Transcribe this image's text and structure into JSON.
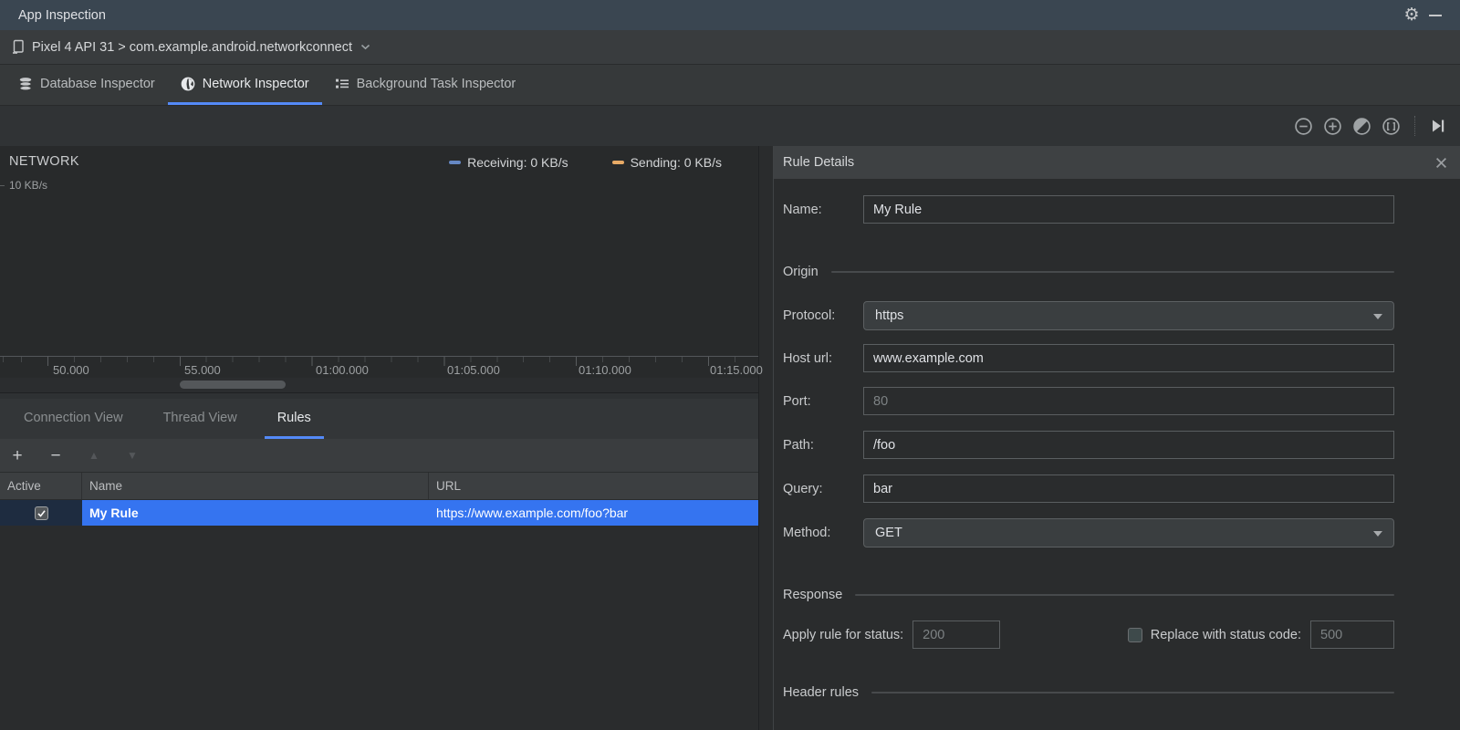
{
  "titlebar": {
    "title": "App Inspection"
  },
  "device_bar": {
    "selection": "Pixel 4 API 31 > com.example.android.networkconnect"
  },
  "inspector_tabs": {
    "items": [
      {
        "label": "Database Inspector",
        "active": false
      },
      {
        "label": "Network Inspector",
        "active": true
      },
      {
        "label": "Background Task Inspector",
        "active": false
      }
    ]
  },
  "timeline": {
    "title": "NETWORK",
    "y_label": "10 KB/s",
    "legend": {
      "receiving": {
        "label": "Receiving: 0 KB/s",
        "color": "#6688c4"
      },
      "sending": {
        "label": "Sending: 0 KB/s",
        "color": "#e8aa66"
      }
    },
    "x_ticks": [
      "50.000",
      "55.000",
      "01:00.000",
      "01:05.000",
      "01:10.000",
      "01:15.000"
    ],
    "receiving_kbs": 0,
    "sending_kbs": 0
  },
  "view_tabs": {
    "items": [
      {
        "label": "Connection View",
        "active": false
      },
      {
        "label": "Thread View",
        "active": false
      },
      {
        "label": "Rules",
        "active": true
      }
    ]
  },
  "rules_toolbar": {
    "add": "+",
    "remove": "−",
    "up": "▲",
    "down": "▼"
  },
  "rules_table": {
    "columns": [
      "Active",
      "Name",
      "URL"
    ],
    "rows": [
      {
        "active": true,
        "name": "My Rule",
        "url": "https://www.example.com/foo?bar",
        "selected": true
      }
    ]
  },
  "rule_details": {
    "title": "Rule Details",
    "name": {
      "label": "Name:",
      "value": "My Rule"
    },
    "sections": {
      "origin": "Origin",
      "response": "Response",
      "header_rules": "Header rules"
    },
    "protocol": {
      "label": "Protocol:",
      "value": "https"
    },
    "host": {
      "label": "Host url:",
      "value": "www.example.com"
    },
    "port": {
      "label": "Port:",
      "value": "80"
    },
    "path": {
      "label": "Path:",
      "value": "/foo"
    },
    "query": {
      "label": "Query:",
      "value": "bar"
    },
    "method": {
      "label": "Method:",
      "value": "GET"
    },
    "status": {
      "apply_label": "Apply rule for status:",
      "apply_value": "200",
      "replace_label": "Replace with status code:",
      "replace_value": "500",
      "replace_checked": false
    }
  },
  "colors": {
    "accent": "#548af7",
    "selection_blue": "#3574f0",
    "titlebar_bg": "#3a4651"
  }
}
